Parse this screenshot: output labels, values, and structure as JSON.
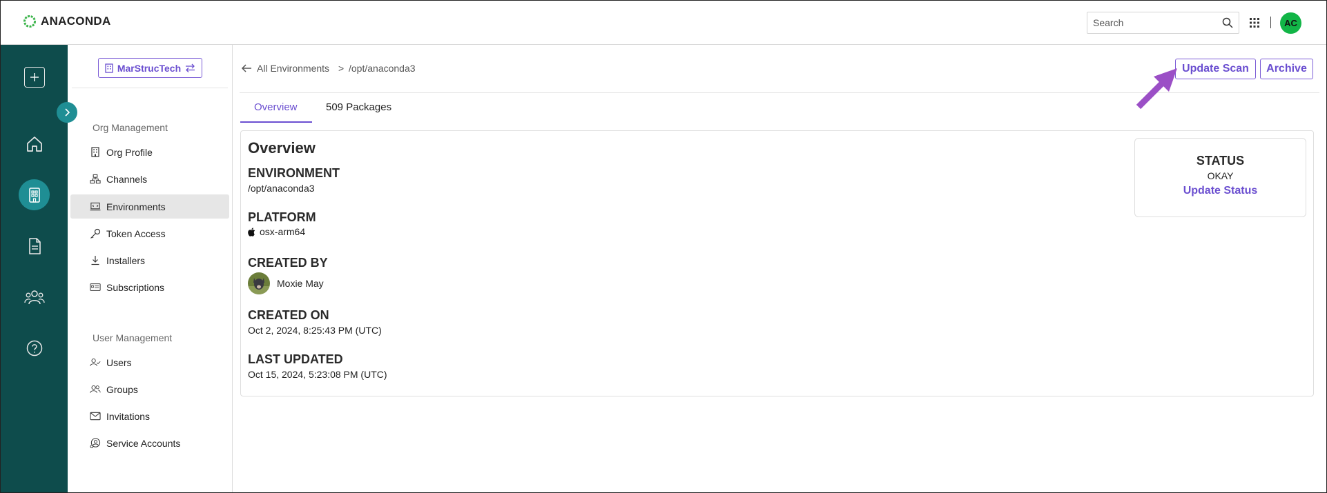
{
  "brand": {
    "name": "ANACONDA"
  },
  "topbar": {
    "search_placeholder": "Search",
    "user_initials": "AC"
  },
  "rail": {
    "items": [
      "add-icon",
      "home-icon",
      "organization-icon",
      "document-icon",
      "people-icon",
      "help-icon"
    ],
    "active": "organization-icon"
  },
  "sidebar": {
    "org_name": "MarStrucTech",
    "org_management_title": "Org Management",
    "org_items": [
      {
        "label": "Org Profile",
        "icon": "building-icon"
      },
      {
        "label": "Channels",
        "icon": "channels-icon"
      },
      {
        "label": "Environments",
        "icon": "environments-icon",
        "active": true
      },
      {
        "label": "Token Access",
        "icon": "key-icon"
      },
      {
        "label": "Installers",
        "icon": "download-icon"
      },
      {
        "label": "Subscriptions",
        "icon": "subscriptions-icon"
      }
    ],
    "user_management_title": "User Management",
    "user_items": [
      {
        "label": "Users",
        "icon": "user-check-icon"
      },
      {
        "label": "Groups",
        "icon": "groups-icon"
      },
      {
        "label": "Invitations",
        "icon": "envelope-icon"
      },
      {
        "label": "Service Accounts",
        "icon": "service-account-icon"
      }
    ]
  },
  "breadcrumb": {
    "parent": "All Environments",
    "separator": ">",
    "current": "/opt/anaconda3"
  },
  "actions": {
    "update_scan": "Update Scan",
    "archive": "Archive"
  },
  "tabs": [
    {
      "label": "Overview",
      "active": true
    },
    {
      "label": "509 Packages"
    }
  ],
  "overview": {
    "title": "Overview",
    "environment_label": "ENVIRONMENT",
    "environment_value": "/opt/anaconda3",
    "platform_label": "PLATFORM",
    "platform_value": "osx-arm64",
    "created_by_label": "CREATED BY",
    "created_by_value": "Moxie May",
    "created_on_label": "CREATED ON",
    "created_on_value": "Oct 2, 2024, 8:25:43 PM (UTC)",
    "last_updated_label": "LAST UPDATED",
    "last_updated_value": "Oct 15, 2024, 5:23:08 PM (UTC)"
  },
  "status": {
    "label": "STATUS",
    "value": "OKAY",
    "action": "Update Status"
  },
  "colors": {
    "rail": "#0e4c4c",
    "rail_active": "#1f8e94",
    "accent": "#6a4ed0",
    "avatar": "#12b547",
    "annotation_arrow": "#9b4fc6"
  }
}
